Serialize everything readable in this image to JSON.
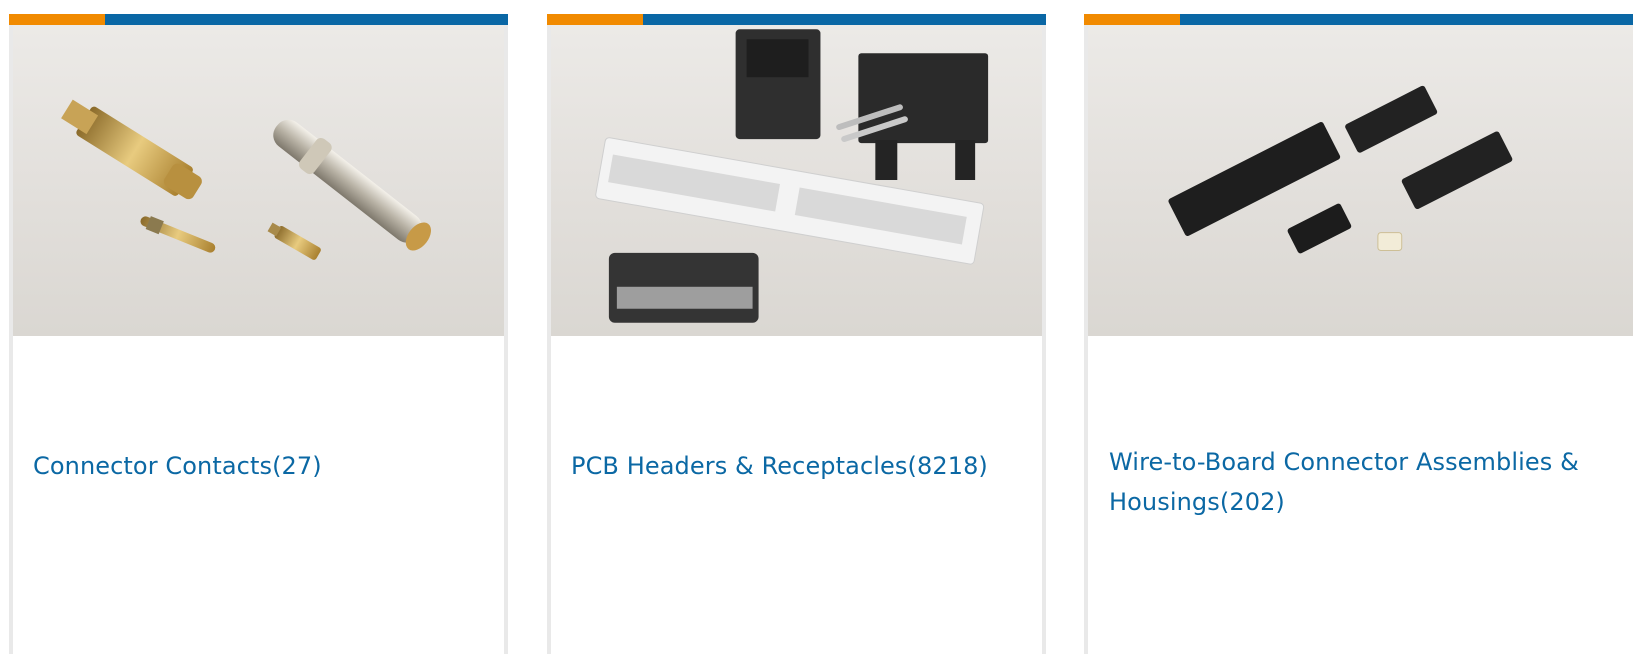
{
  "categories": [
    {
      "label": "Connector Contacts(27)"
    },
    {
      "label": "PCB Headers & Receptacles(8218)"
    },
    {
      "label": "Wire-to-Board Connector Assemblies & Housings(202)"
    }
  ],
  "colors": {
    "accent_orange": "#f18a00",
    "accent_blue": "#0a67a5",
    "link_blue": "#0b68a4"
  }
}
